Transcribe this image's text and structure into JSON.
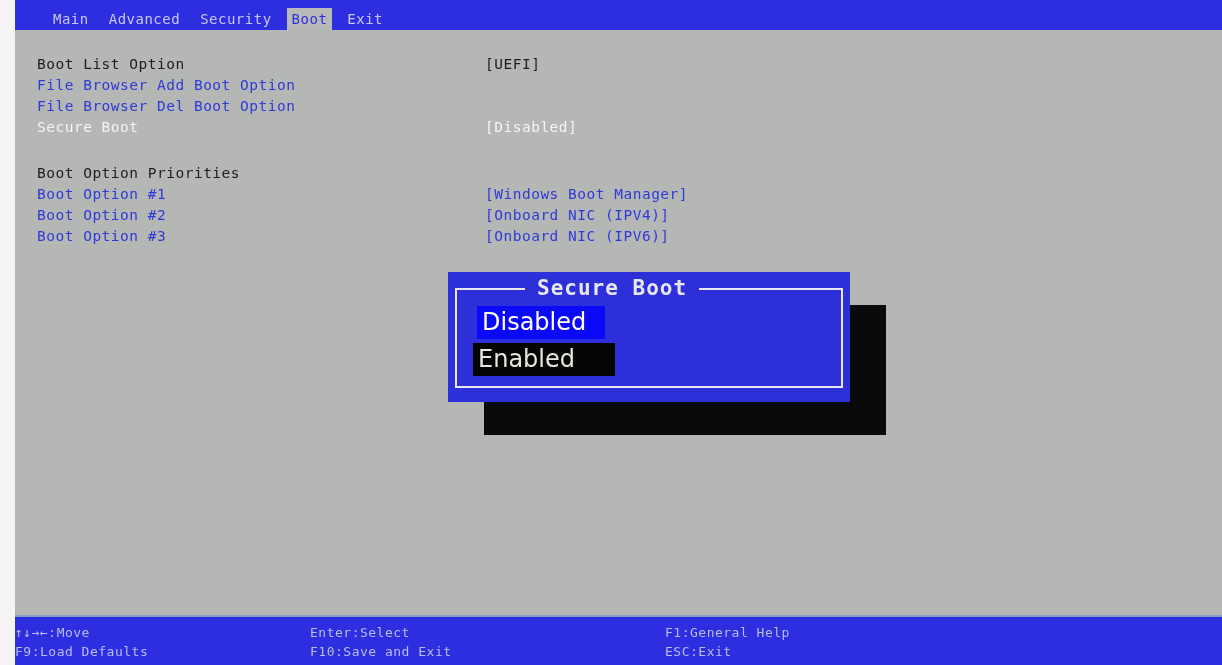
{
  "tabs": [
    {
      "label": "Main",
      "selected": false
    },
    {
      "label": "Advanced",
      "selected": false
    },
    {
      "label": "Security",
      "selected": false
    },
    {
      "label": "Boot",
      "selected": true
    },
    {
      "label": "Exit",
      "selected": false
    }
  ],
  "settings": [
    {
      "kind": "static",
      "label": "Boot List Option",
      "value": "[UEFI]",
      "selected": false
    },
    {
      "kind": "item",
      "label": "File Browser Add Boot Option",
      "selected": false
    },
    {
      "kind": "item",
      "label": "File Browser Del Boot Option",
      "selected": false
    },
    {
      "kind": "item",
      "label": "Secure Boot",
      "value": "[Disabled]",
      "selected": true
    },
    {
      "kind": "gap"
    },
    {
      "kind": "static",
      "label": "Boot Option Priorities",
      "selected": false
    },
    {
      "kind": "item",
      "label": "Boot Option #1",
      "value": "[Windows Boot Manager]",
      "selected": false
    },
    {
      "kind": "item",
      "label": "Boot Option #2",
      "value": "[Onboard NIC (IPV4)]",
      "selected": false
    },
    {
      "kind": "item",
      "label": "Boot Option #3",
      "value": "[Onboard NIC (IPV6)]",
      "selected": false
    }
  ],
  "popup": {
    "title": "Secure Boot",
    "options": [
      {
        "label": "Disabled",
        "current": true,
        "selected": false
      },
      {
        "label": "Enabled",
        "current": false,
        "selected": true
      }
    ]
  },
  "help": [
    [
      "↑↓→←:Move",
      "Enter:Select",
      "F1:General Help"
    ],
    [
      "F9:Load Defaults",
      "F10:Save and Exit",
      "ESC:Exit"
    ]
  ]
}
